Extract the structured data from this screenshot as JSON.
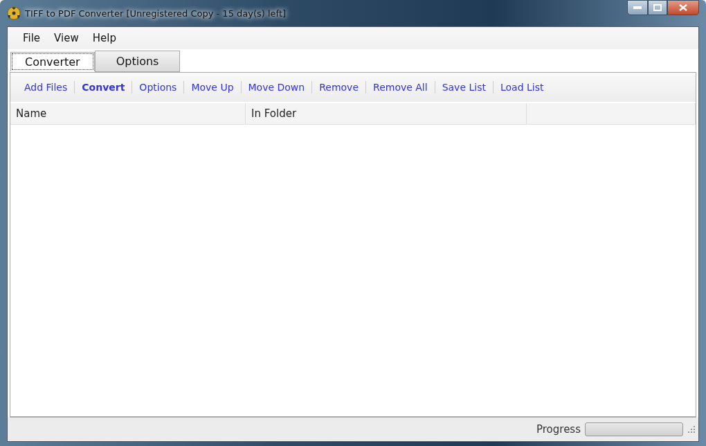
{
  "window": {
    "title": "TIFF to PDF Converter [Unregistered Copy - 15 day(s) left]"
  },
  "menu": [
    "File",
    "View",
    "Help"
  ],
  "tabs": [
    {
      "label": "Converter",
      "selected": true
    },
    {
      "label": "Options",
      "selected": false
    }
  ],
  "toolbar": [
    {
      "label": "Add Files",
      "kind": "link"
    },
    {
      "label": "Convert",
      "kind": "primary"
    },
    {
      "label": "Options",
      "kind": "link"
    },
    {
      "label": "Move Up",
      "kind": "link"
    },
    {
      "label": "Move Down",
      "kind": "link"
    },
    {
      "label": "Remove",
      "kind": "link"
    },
    {
      "label": "Remove All",
      "kind": "link"
    },
    {
      "label": "Save List",
      "kind": "link"
    },
    {
      "label": "Load List",
      "kind": "link"
    }
  ],
  "table": {
    "columns": [
      "Name",
      "In Folder"
    ]
  },
  "status_bar": {
    "progress_label": "Progress",
    "level": 0
  }
}
